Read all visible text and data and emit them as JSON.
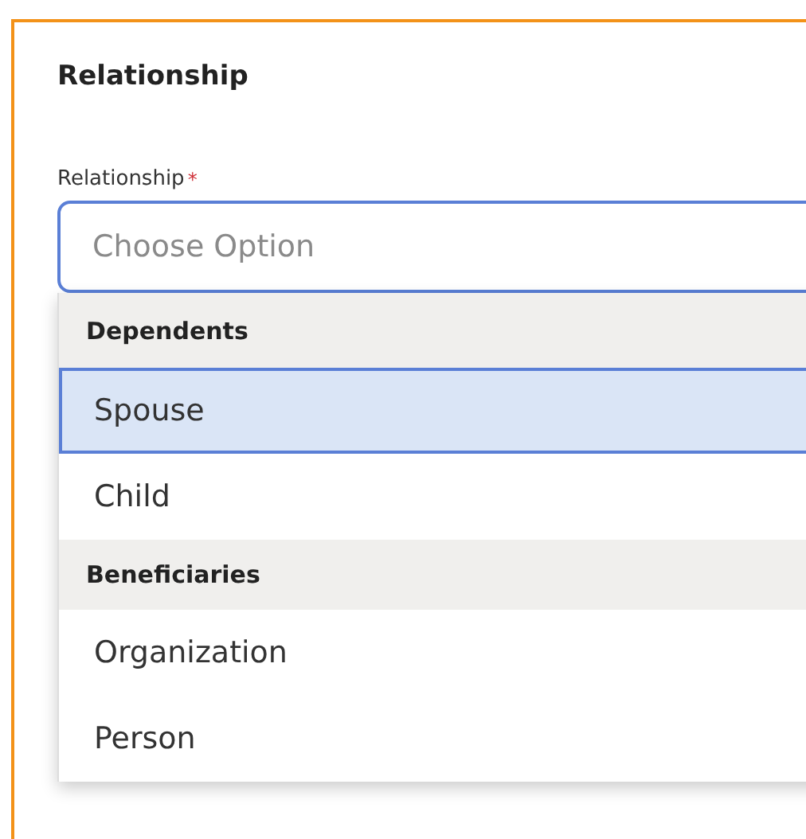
{
  "panel": {
    "title": "Relationship"
  },
  "field": {
    "label": "Relationship",
    "required_mark": "*",
    "placeholder": "Choose Option",
    "expanded": true
  },
  "dropdown": {
    "groups": [
      {
        "heading": "Dependents",
        "options": [
          {
            "label": "Spouse",
            "selected": true
          },
          {
            "label": "Child",
            "selected": false
          }
        ]
      },
      {
        "heading": "Beneficiaries",
        "options": [
          {
            "label": "Organization",
            "selected": false
          },
          {
            "label": "Person",
            "selected": false
          }
        ]
      }
    ]
  }
}
